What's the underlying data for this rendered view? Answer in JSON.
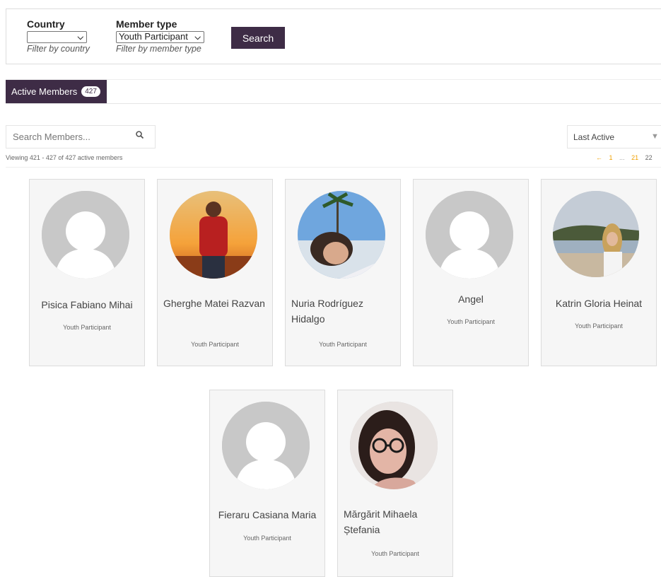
{
  "filters": {
    "country": {
      "label": "Country",
      "value": "",
      "help": "Filter by country"
    },
    "member_type": {
      "label": "Member type",
      "value": "Youth Participant",
      "help": "Filter by member type"
    },
    "search_button": "Search"
  },
  "tabs": {
    "active_label": "Active Members",
    "active_count": "427"
  },
  "search": {
    "placeholder": "Search Members..."
  },
  "order": {
    "value": "Last Active"
  },
  "viewing_text": "Viewing 421 - 427 of 427 active members",
  "pagination": {
    "prev": "←",
    "first": "1",
    "dots": "...",
    "prev_page": "21",
    "current": "22"
  },
  "colors": {
    "accent": "#3e2c46",
    "page_link": "#f0a000",
    "card_bg": "#f6f6f6"
  },
  "members": [
    {
      "name": "Pisica Fabiano Mihai",
      "type": "Youth Participant",
      "avatar": "default-avatar"
    },
    {
      "name": "Gherghe Matei Razvan",
      "type": "Youth Participant",
      "avatar": "photo-sunset-man"
    },
    {
      "name": "Nuria Rodríguez Hidalgo",
      "type": "Youth Participant",
      "avatar": "photo-palm-girl"
    },
    {
      "name": "Angel",
      "type": "Youth Participant",
      "avatar": "default-avatar"
    },
    {
      "name": "Katrin Gloria Heinat",
      "type": "Youth Participant",
      "avatar": "photo-beach-girl"
    },
    {
      "name": "Fieraru Casiana Maria",
      "type": "Youth Participant",
      "avatar": "default-avatar"
    },
    {
      "name": "Mărgărit Mihaela Ștefania",
      "type": "Youth Participant",
      "avatar": "photo-glasses-girl"
    }
  ]
}
